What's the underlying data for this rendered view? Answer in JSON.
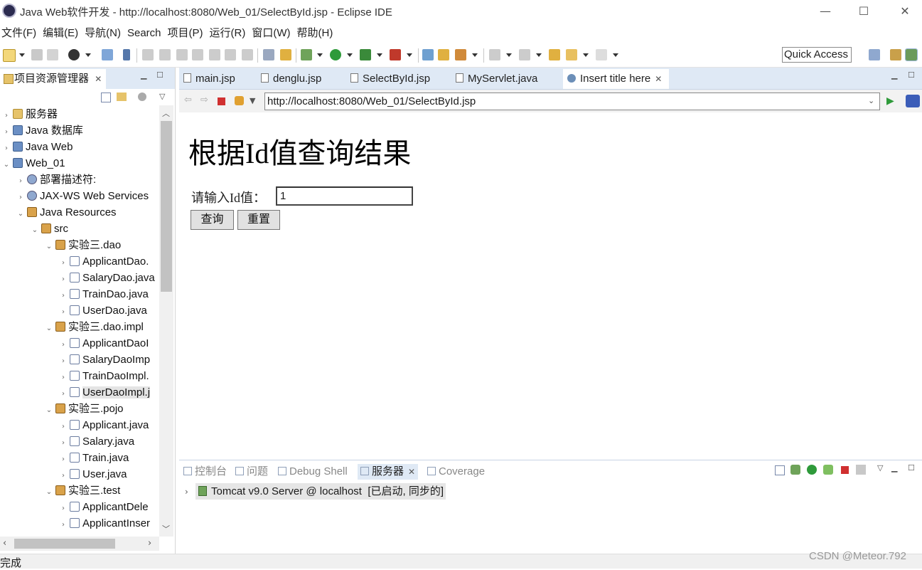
{
  "window": {
    "title": "Java Web软件开发 - http://localhost:8080/Web_01/SelectById.jsp - Eclipse IDE",
    "minimize": "—",
    "maximize": "☐",
    "close": "✕"
  },
  "menubar": [
    "文件(F)",
    "编辑(E)",
    "导航(N)",
    "Search",
    "项目(P)",
    "运行(R)",
    "窗口(W)",
    "帮助(H)"
  ],
  "toolbar": {
    "quick_access": "Quick Access"
  },
  "left_panel": {
    "tab_label": "项目资源管理器",
    "tree": [
      {
        "label": "服务器",
        "indent": 0,
        "twisty": "›",
        "icon": "folder-icon"
      },
      {
        "label": "Java 数据库",
        "indent": 0,
        "twisty": "›",
        "icon": "project-icon"
      },
      {
        "label": "Java Web",
        "indent": 0,
        "twisty": "›",
        "icon": "project-icon"
      },
      {
        "label": "Web_01",
        "indent": 0,
        "twisty": "⌄",
        "icon": "project-icon"
      },
      {
        "label": "部署描述符:",
        "indent": 1,
        "twisty": "›",
        "icon": "gear-icon"
      },
      {
        "label": "JAX-WS Web Services",
        "indent": 1,
        "twisty": "›",
        "icon": "gear-icon"
      },
      {
        "label": "Java Resources",
        "indent": 1,
        "twisty": "⌄",
        "icon": "package-icon"
      },
      {
        "label": "src",
        "indent": 2,
        "twisty": "⌄",
        "icon": "package-icon"
      },
      {
        "label": "实验三.dao",
        "indent": 3,
        "twisty": "⌄",
        "icon": "package-icon"
      },
      {
        "label": "ApplicantDao.",
        "indent": 4,
        "twisty": "›",
        "icon": "java-icon"
      },
      {
        "label": "SalaryDao.java",
        "indent": 4,
        "twisty": "›",
        "icon": "java-icon"
      },
      {
        "label": "TrainDao.java",
        "indent": 4,
        "twisty": "›",
        "icon": "java-icon"
      },
      {
        "label": "UserDao.java",
        "indent": 4,
        "twisty": "›",
        "icon": "java-icon"
      },
      {
        "label": "实验三.dao.impl",
        "indent": 3,
        "twisty": "⌄",
        "icon": "package-icon"
      },
      {
        "label": "ApplicantDaoI",
        "indent": 4,
        "twisty": "›",
        "icon": "java-icon"
      },
      {
        "label": "SalaryDaoImp",
        "indent": 4,
        "twisty": "›",
        "icon": "java-icon"
      },
      {
        "label": "TrainDaoImpl.",
        "indent": 4,
        "twisty": "›",
        "icon": "java-icon"
      },
      {
        "label": "UserDaoImpl.j",
        "indent": 4,
        "twisty": "›",
        "icon": "java-icon",
        "selected": true
      },
      {
        "label": "实验三.pojo",
        "indent": 3,
        "twisty": "⌄",
        "icon": "package-icon"
      },
      {
        "label": "Applicant.java",
        "indent": 4,
        "twisty": "›",
        "icon": "java-icon"
      },
      {
        "label": "Salary.java",
        "indent": 4,
        "twisty": "›",
        "icon": "java-icon"
      },
      {
        "label": "Train.java",
        "indent": 4,
        "twisty": "›",
        "icon": "java-icon"
      },
      {
        "label": "User.java",
        "indent": 4,
        "twisty": "›",
        "icon": "java-icon"
      },
      {
        "label": "实验三.test",
        "indent": 3,
        "twisty": "⌄",
        "icon": "package-icon"
      },
      {
        "label": "ApplicantDele",
        "indent": 4,
        "twisty": "›",
        "icon": "java-icon"
      },
      {
        "label": "ApplicantInser",
        "indent": 4,
        "twisty": "›",
        "icon": "java-icon"
      }
    ]
  },
  "editor": {
    "tabs": [
      "main.jsp",
      "denglu.jsp",
      "SelectById.jsp",
      "MyServlet.java",
      "Insert title here"
    ],
    "url": "http://localhost:8080/Web_01/SelectById.jsp",
    "page": {
      "heading": "根据Id值查询结果",
      "id_label": "请输入Id值：",
      "id_value": "1",
      "query_button": "查询",
      "reset_button": "重置"
    }
  },
  "bottom_panel": {
    "tabs": [
      "控制台",
      "问题",
      "Debug Shell",
      "服务器",
      "Coverage"
    ],
    "server_entry": "Tomcat v9.0 Server @ localhost  [已启动, 同步的]"
  },
  "status": {
    "text": "完成",
    "watermark": "CSDN @Meteor.792"
  }
}
